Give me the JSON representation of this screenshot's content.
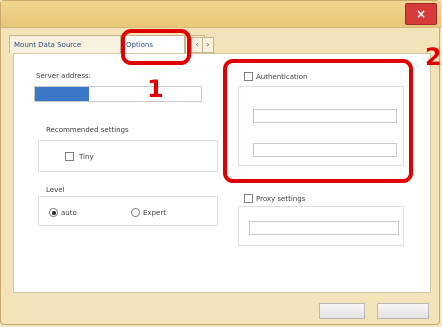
{
  "window": {
    "title": "",
    "close_glyph": "×"
  },
  "tabs": [
    {
      "label": "Mount Data Source"
    },
    {
      "label": "Options"
    },
    {
      "label": ""
    }
  ],
  "left": {
    "section_label": "Server address:",
    "server_value": "",
    "recommended_label": "Recommended settings",
    "recommended_checkbox_label": "Tiny",
    "level_label": "Level",
    "radio_1_label": "auto",
    "radio_2_label": "Expert"
  },
  "right": {
    "auth_checkbox_label": "Authentication",
    "username_placeholder": "",
    "password_placeholder": "",
    "proxy_checkbox_label": "Proxy settings",
    "proxy_value": ""
  },
  "annotations": [
    {
      "label": "1"
    },
    {
      "label": "2"
    }
  ],
  "footer": {
    "ok_label": "",
    "cancel_label": ""
  },
  "colors": {
    "highlight": "#e00000",
    "selected_field": "#3b78c8"
  },
  "icons": {
    "close": "close-icon",
    "tab_scroll_left": "chevron-left-icon",
    "tab_scroll_right": "chevron-right-icon"
  }
}
